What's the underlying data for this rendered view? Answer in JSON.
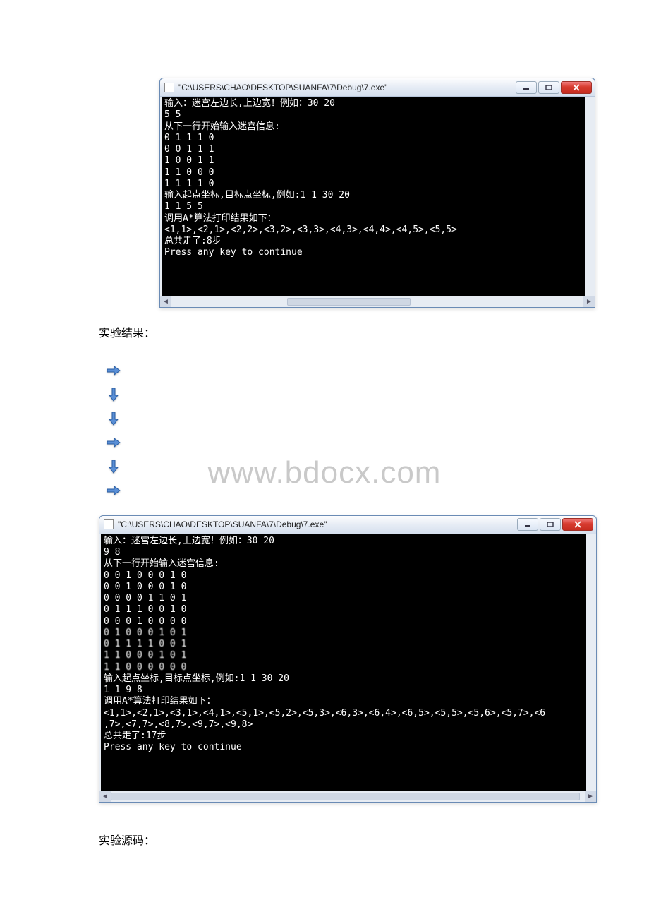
{
  "watermark": "www.bdocx.com",
  "labels": {
    "results": "实验结果：",
    "source": "实验源码："
  },
  "arrow_directions": [
    "right",
    "down",
    "down",
    "right",
    "down",
    "right"
  ],
  "window1": {
    "title": "\"C:\\USERS\\CHAO\\DESKTOP\\SUANFA\\7\\Debug\\7.exe\"",
    "lines": [
      "输入：迷宫左边长,上边宽！例如：30 20",
      "5 5",
      "从下一行开始输入迷宫信息:",
      "0 1 1 1 0",
      "0 0 1 1 1",
      "1 0 0 1 1",
      "1 1 0 0 0",
      "1 1 1 1 0",
      "输入起点坐标,目标点坐标,例如:1 1 30 20",
      "1 1 5 5",
      "调用A*算法打印结果如下：",
      "<1,1>,<2,1>,<2,2>,<3,2>,<3,3>,<4,3>,<4,4>,<4,5>,<5,5>",
      "总共走了:8步",
      "Press any key to continue"
    ]
  },
  "window2": {
    "title": "\"C:\\USERS\\CHAO\\DESKTOP\\SUANFA\\7\\Debug\\7.exe\"",
    "lines": [
      "输入：迷宫左边长,上边宽！例如：30 20",
      "9 8",
      "从下一行开始输入迷宫信息:",
      "0 0 1 0 0 0 1 0",
      "0 0 1 0 0 0 1 0",
      "0 0 0 0 1 1 0 1",
      "0 1 1 1 0 0 1 0",
      "0 0 0 1 0 0 0 0",
      "0 1 0 0 0 1 0 1",
      "0 1 1 1 1 0 0 1",
      "1 1 0 0 0 1 0 1",
      "1 1 0 0 0 0 0 0",
      "输入起点坐标,目标点坐标,例如:1 1 30 20",
      "1 1 9 8",
      "调用A*算法打印结果如下：",
      "<1,1>,<2,1>,<3,1>,<4,1>,<5,1>,<5,2>,<5,3>,<6,3>,<6,4>,<6,5>,<5,5>,<5,6>,<5,7>,<6",
      ",7>,<7,7>,<8,7>,<9,7>,<9,8>",
      "总共走了:17步",
      "Press any key to continue"
    ]
  }
}
